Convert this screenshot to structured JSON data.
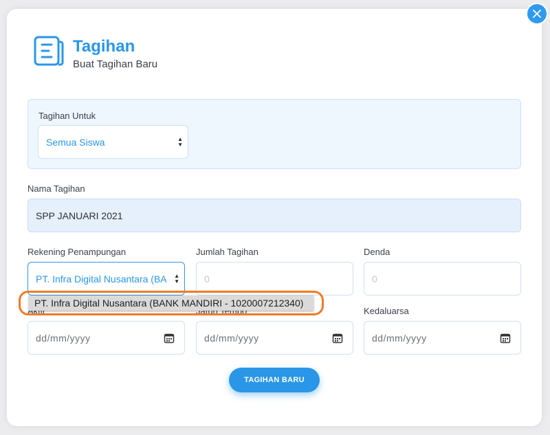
{
  "header": {
    "title": "Tagihan",
    "subtitle": "Buat Tagihan Baru",
    "icon": "document-icon"
  },
  "form": {
    "tagihan_untuk": {
      "label": "Tagihan Untuk",
      "value": "Semua Siswa"
    },
    "nama_tagihan": {
      "label": "Nama Tagihan",
      "value": "SPP JANUARI 2021"
    },
    "rekening_penampungan": {
      "label": "Rekening Penampungan",
      "value": "PT. Infra Digital Nusantara (BA",
      "options": [
        "PT. Infra Digital Nusantara (BANK MANDIRI - 1020007212340)"
      ]
    },
    "jumlah_tagihan": {
      "label": "Jumlah Tagihan",
      "placeholder": "0"
    },
    "denda": {
      "label": "Denda",
      "placeholder": "0"
    },
    "aktif": {
      "label": "Aktif",
      "placeholder": "dd/mm/yyyy"
    },
    "jatuh_tempo": {
      "label": "Jatuh Tempo",
      "placeholder": "dd/mm/yyyy"
    },
    "kedaluarsa": {
      "label": "Kedaluarsa",
      "placeholder": "dd/mm/yyyy"
    }
  },
  "actions": {
    "submit_label": "TAGIHAN BARU",
    "close": "close-icon"
  },
  "colors": {
    "accent": "#2a96e8",
    "panel_bg": "#eef6fe",
    "highlight": "#f07a24"
  }
}
